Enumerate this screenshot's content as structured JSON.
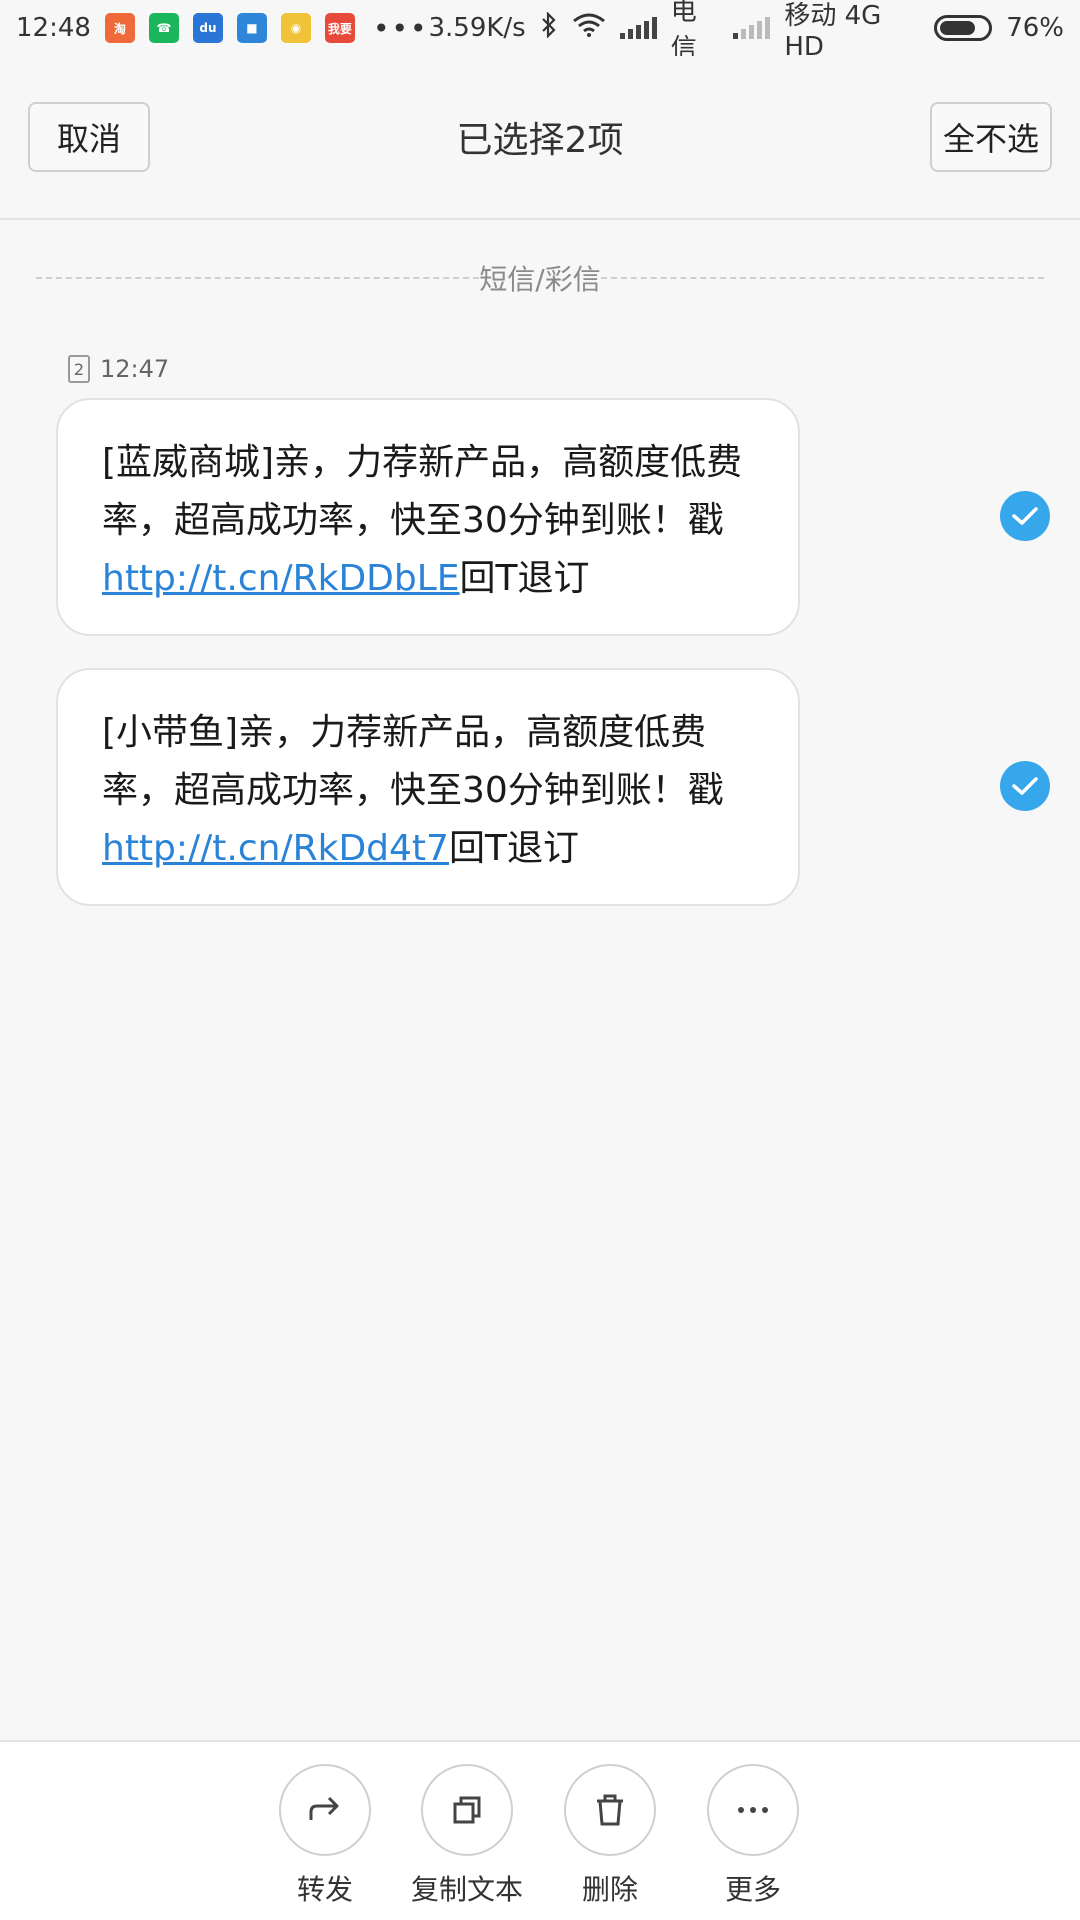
{
  "status_bar": {
    "time": "12:48",
    "apps": [
      {
        "icon": "taobao-icon",
        "text": "淘",
        "color": "#ee6a3a"
      },
      {
        "icon": "phone-icon",
        "text": "☎",
        "color": "#1bb55c"
      },
      {
        "icon": "app-blue-icon",
        "text": "du",
        "color": "#2a76d6"
      },
      {
        "icon": "app-note-icon",
        "text": "■",
        "color": "#2f86d8"
      },
      {
        "icon": "app-yellow-icon",
        "text": "◉",
        "color": "#f1c338"
      },
      {
        "icon": "app-red-icon",
        "text": "我要",
        "color": "#e74a3b"
      }
    ],
    "more_dots": "•••",
    "speed": "3.59K/s",
    "carrier1": "电信",
    "carrier2": "移动 4G HD",
    "battery_percent": "76%",
    "battery_level": 0.76
  },
  "header": {
    "cancel_label": "取消",
    "title": "已选择2项",
    "deselect_all_label": "全不选"
  },
  "section": {
    "label": "短信/彩信"
  },
  "messages_meta": {
    "sim": "2",
    "time": "12:47"
  },
  "messages": [
    {
      "text_before": "[蓝威商城]亲，力荐新产品，高额度低费率，超高成功率，快至30分钟到账！戳",
      "link": "http://t.cn/RkDDbLE",
      "text_after": "回T退订",
      "selected": true
    },
    {
      "text_before": "[小带鱼]亲，力荐新产品，高额度低费率，超高成功率，快至30分钟到账！戳",
      "link": "http://t.cn/RkDd4t7",
      "text_after": "回T退订",
      "selected": true
    }
  ],
  "toolbar": {
    "forward_label": "转发",
    "copy_label": "复制文本",
    "delete_label": "删除",
    "more_label": "更多"
  },
  "colors": {
    "accent": "#37a7ec",
    "link": "#2a83d7"
  }
}
